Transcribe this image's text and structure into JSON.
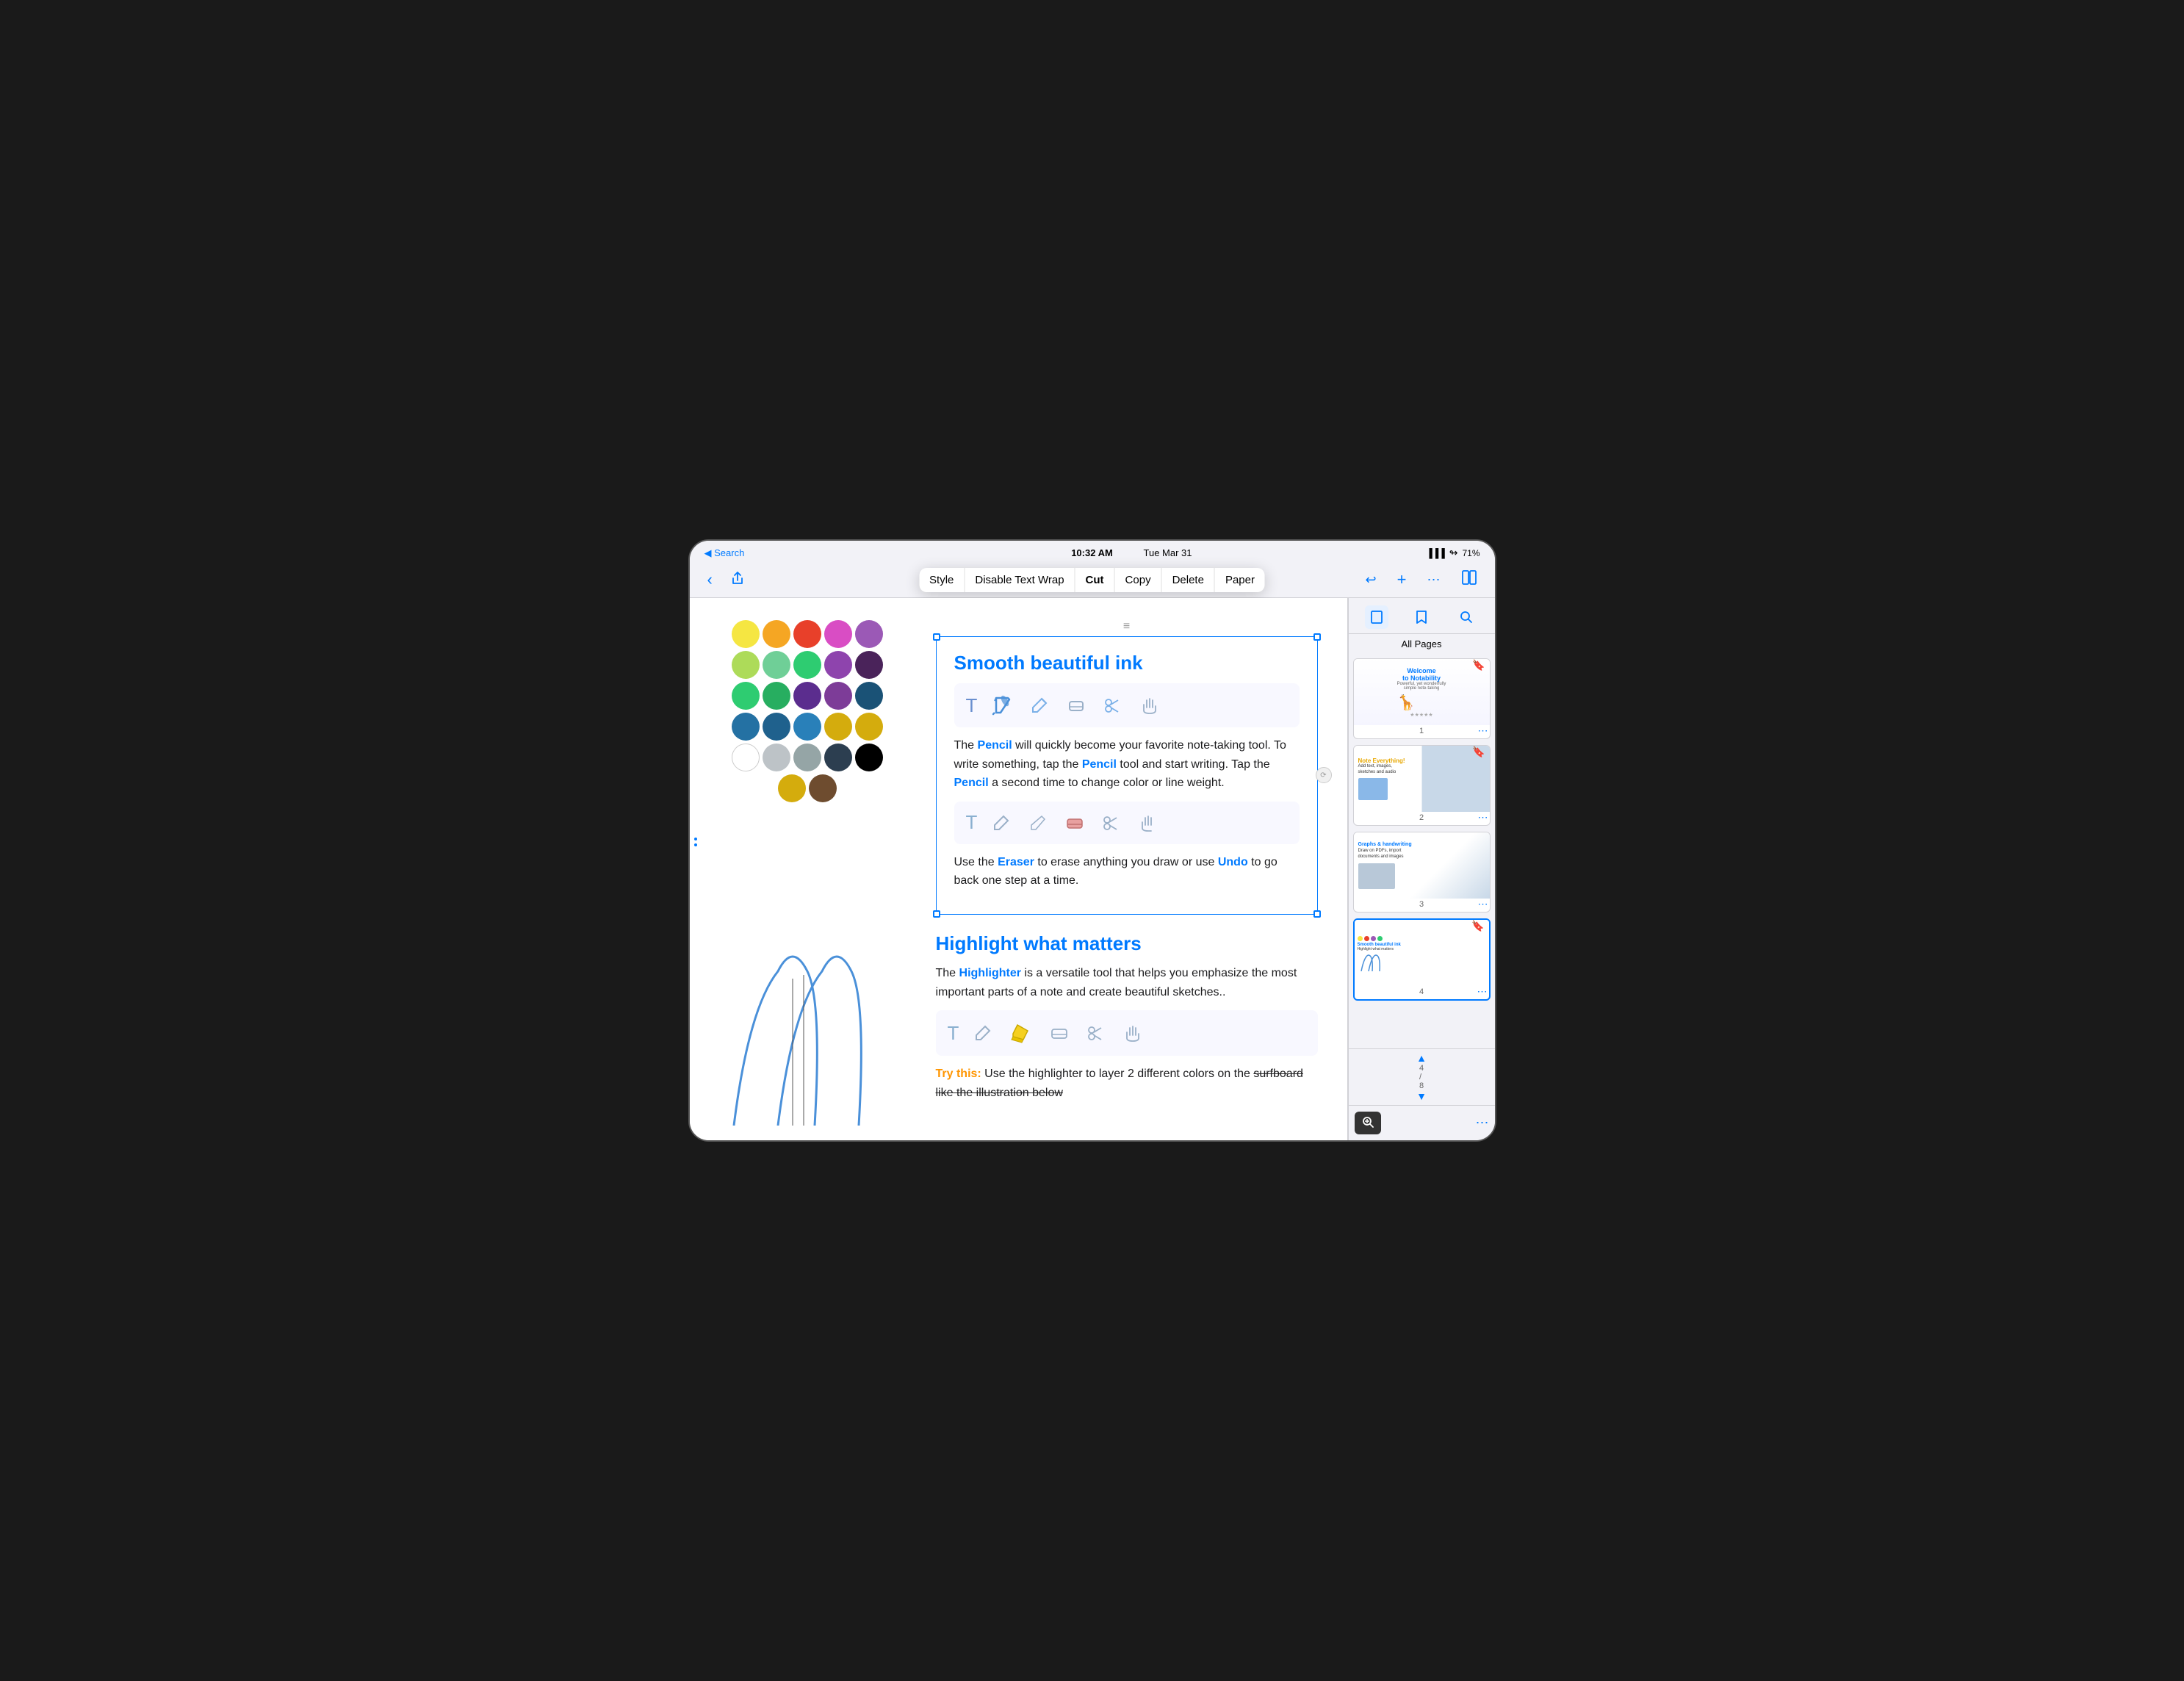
{
  "status": {
    "back_label": "◀ Search",
    "time": "10:32 AM",
    "date": "Tue Mar 31",
    "signal": "▐▐▐",
    "wifi": "WiFi",
    "battery": "71%"
  },
  "toolbar": {
    "back_icon": "‹",
    "share_icon": "↑",
    "undo_icon": "↩",
    "context_menu": {
      "items": [
        "Style",
        "Disable Text Wrap",
        "Cut",
        "Copy",
        "Delete",
        "Paper"
      ]
    },
    "right_icons": {
      "add": "+",
      "more": "···",
      "book": "📖"
    }
  },
  "sidebar": {
    "all_pages_label": "All Pages",
    "tools": [
      "pages",
      "bookmark",
      "search"
    ],
    "pages": [
      {
        "num": "1",
        "title": "Welcome to Notability",
        "subtitle": "Powerful, yet wonderfully simple note-taking",
        "bookmark": true
      },
      {
        "num": "2",
        "title": "Note Everything!",
        "has_image": true,
        "bookmark": true
      },
      {
        "num": "3",
        "title": "",
        "has_image": true,
        "bookmark": false
      },
      {
        "num": "4",
        "title": "",
        "active": true,
        "bookmark": true
      }
    ],
    "zoom_icon": "⊕",
    "more_icon": "···"
  },
  "document": {
    "section1": {
      "heading": "Smooth beautiful ink",
      "body1": "The",
      "pencil_link": "Pencil",
      "body2": "will quickly become your favorite note-taking tool. To write something, tap the",
      "pencil_link2": "Pencil",
      "body3": "tool and start writing. Tap the",
      "pencil_link3": "Pencil",
      "body4": "a second time to change color or line weight.",
      "eraser_desc1": "Use the",
      "eraser_link": "Eraser",
      "eraser_desc2": "to erase anything you draw or use",
      "undo_link": "Undo",
      "eraser_desc3": "to go back one step at a time."
    },
    "section2": {
      "heading": "Highlight what matters",
      "body1": "The",
      "highlighter_link": "Highlighter",
      "body2": "is a versatile tool that helps you emphasize the most important parts of a note and create beautiful sketches..",
      "try_this_label": "Try this:",
      "try_this_body": "Use the highlighter to layer 2 different colors on the surfboard like the illustration below"
    }
  },
  "colors": {
    "row1": [
      "#f5e642",
      "#f5a623",
      "#e8402a",
      "#d94dc4",
      "#9b59b6"
    ],
    "row2": [
      "#addb59",
      "#6fcf97",
      "#2ecc71",
      "#8e44ad",
      "#4a235a"
    ],
    "row3": [
      "#2ecc71",
      "#27ae60",
      "#5b2d8e",
      "#7d3c98",
      "#6c3483"
    ],
    "row4": [
      "#1a5276",
      "#2471a3",
      "#1f618d",
      "#2980b9",
      "#d4ac0d"
    ],
    "row5": [
      "#ffffff",
      "#bdc3c7",
      "#95a5a6",
      "#2c3e50",
      "#6e4c2f"
    ]
  }
}
